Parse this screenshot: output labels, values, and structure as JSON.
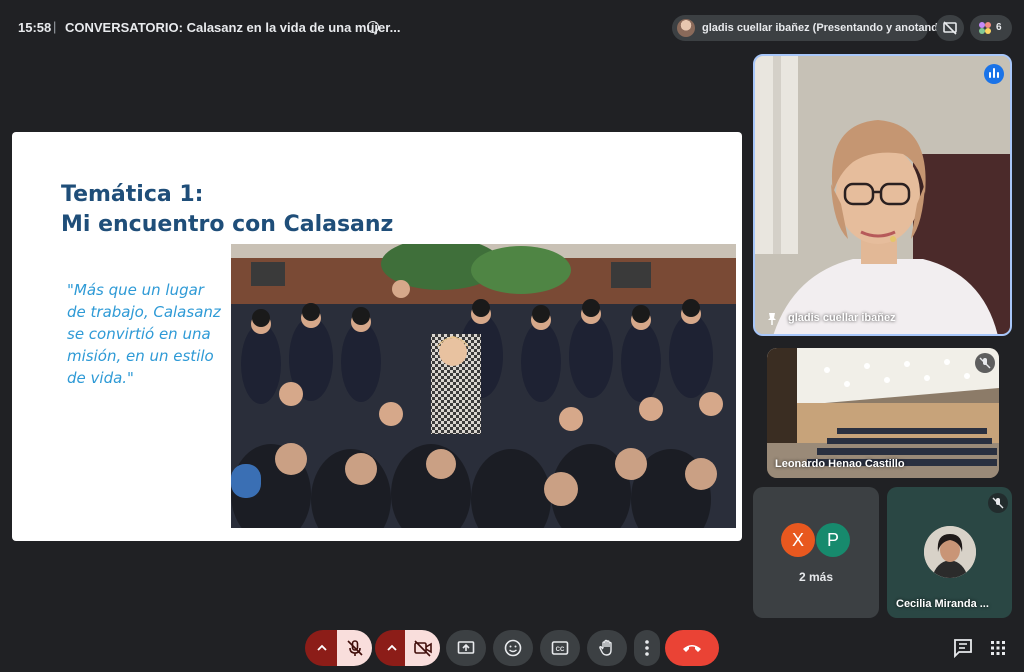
{
  "header": {
    "time": "15:58",
    "separator": "|",
    "meeting_title": "CONVERSATORIO: Calasanz en la vida de una mujer...",
    "presenter_chip": "gladis cuellar ibañez (Presentando y anotando)",
    "participant_count": "6"
  },
  "slide": {
    "title_line1": "Temática 1:",
    "title_line2": "Mi encuentro con Calasanz",
    "quote": "\"Más que un lugar de trabajo, Calasanz se convirtió en una misión, en un estilo de vida.\""
  },
  "participants": {
    "main_tile_name": "gladis cuellar ibañez",
    "room_tile_name": "Leonardo Henao Castillo",
    "more_avatars": [
      {
        "letter": "X",
        "color": "#e8581f"
      },
      {
        "letter": "P",
        "color": "#178a6d"
      }
    ],
    "more_label": "2 más",
    "cecilia_name": "Cecilia Miranda ..."
  },
  "colors": {
    "background": "#202124",
    "end_call": "#ea4335",
    "muted_control_bg": "#8c1d18",
    "muted_control_icon_bg": "#f9dedc",
    "speaking_border": "#a8c7fa",
    "slide_title": "#1f4e79",
    "slide_quote": "#2e9ad6"
  },
  "icons": {
    "header": [
      "info-icon",
      "stop-presenting-icon",
      "people-icon"
    ],
    "controls": [
      "chevron-up-icon",
      "mic-off-icon",
      "chevron-up-icon",
      "camera-off-icon",
      "present-screen-icon",
      "emoji-icon",
      "captions-icon",
      "raise-hand-icon",
      "more-options-icon",
      "end-call-icon"
    ],
    "side": [
      "chat-icon",
      "apps-icon"
    ]
  }
}
